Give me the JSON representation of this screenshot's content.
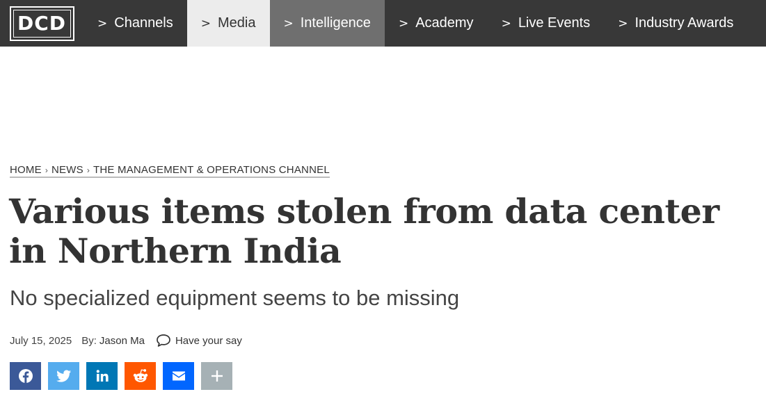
{
  "brand": {
    "logo_text": "DCD"
  },
  "nav": {
    "items": [
      {
        "label": "Channels"
      },
      {
        "label": "Media"
      },
      {
        "label": "Intelligence"
      },
      {
        "label": "Academy"
      },
      {
        "label": "Live Events"
      },
      {
        "label": "Industry Awards"
      }
    ],
    "chevron": ">"
  },
  "breadcrumb": {
    "items": [
      "HOME",
      "NEWS",
      "THE MANAGEMENT & OPERATIONS CHANNEL"
    ],
    "separator": "›"
  },
  "article": {
    "title": "Various items stolen from data center in Northern India",
    "subtitle": "No specialized equipment seems to be missing",
    "date": "July 15, 2025",
    "by_label": "By:",
    "author": "Jason Ma",
    "comment_label": "Have your say"
  },
  "share": {
    "buttons": [
      {
        "icon": "facebook-icon",
        "color": "#3b5998"
      },
      {
        "icon": "twitter-icon",
        "color": "#55acee"
      },
      {
        "icon": "linkedin-icon",
        "color": "#0077b5"
      },
      {
        "icon": "reddit-icon",
        "color": "#ff5700"
      },
      {
        "icon": "email-icon",
        "color": "#0166ff"
      },
      {
        "icon": "plus-icon",
        "color": "#a6b1b5"
      }
    ]
  },
  "colors": {
    "nav_background": "#383838",
    "nav_active": "#ececec",
    "nav_hover": "#6f6f6f"
  }
}
